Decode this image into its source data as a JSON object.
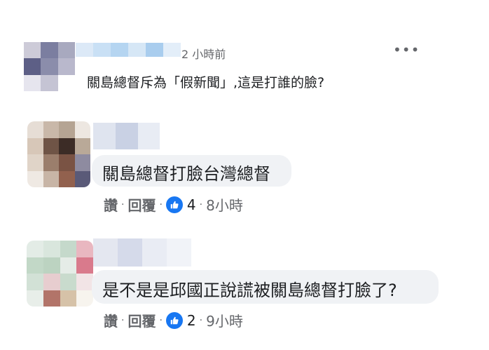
{
  "comments": [
    {
      "timestamp": "2 小時前",
      "text": "關島總督斥為「假新聞」,這是打誰的臉?"
    },
    {
      "text": "關島總督打臉台灣總督",
      "actions": {
        "like": "讚",
        "reply": "回覆"
      },
      "reactions": "4",
      "timestamp": "8小時"
    },
    {
      "text": "是不是是邱國正說謊被關島總督打臉了?",
      "actions": {
        "like": "讚",
        "reply": "回覆"
      },
      "reactions": "2",
      "timestamp": "9小時"
    }
  ],
  "menu_icon": "more-options-icon",
  "accent_color": "#1877f2"
}
